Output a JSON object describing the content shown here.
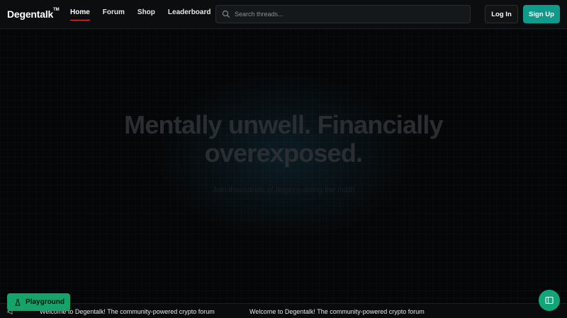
{
  "app": {
    "logo_text": "Degentalk",
    "logo_mark": "TM"
  },
  "nav": {
    "items": [
      {
        "label": "Home",
        "active": true
      },
      {
        "label": "Forum",
        "active": false
      },
      {
        "label": "Shop",
        "active": false
      },
      {
        "label": "Leaderboard",
        "active": false
      }
    ]
  },
  "search": {
    "placeholder": "Search threads..."
  },
  "auth": {
    "login_label": "Log In",
    "signup_label": "Sign Up"
  },
  "hero": {
    "title": "Mentally unwell. Financially overexposed.",
    "subtitle": "Join thousands of degens doing the math"
  },
  "ticker": {
    "messages": [
      "Welcome to Degentalk! The community-powered crypto forum",
      "Welcome to Degentalk! The community-powered crypto forum"
    ]
  },
  "floating": {
    "playground_label": "Playground"
  },
  "colors": {
    "accent_teal": "#0f9a8c",
    "accent_green": "#15a36a",
    "active_underline": "#ef4444",
    "background": "#050607"
  },
  "icons": {
    "search": "search-icon",
    "ticker": "megaphone-icon",
    "playground": "flask-icon",
    "panel": "sidebar-panel-icon"
  }
}
